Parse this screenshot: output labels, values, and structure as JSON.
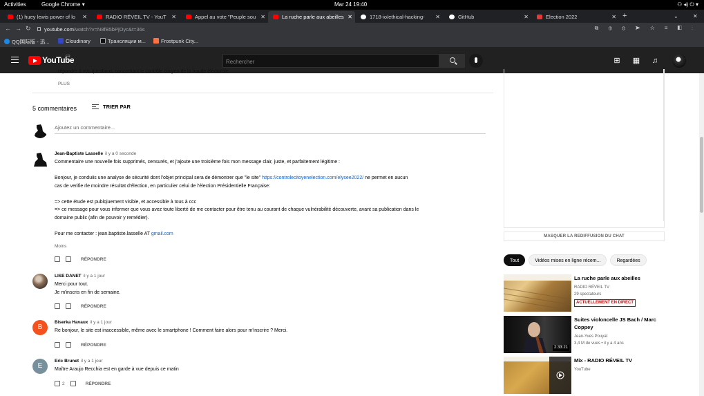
{
  "system": {
    "activities": "Activities",
    "app": "Google Chrome ▾",
    "clock": "Mar 24  19:40"
  },
  "tabs": [
    {
      "label": "(1) huey lewis power of lo",
      "icon": "youtube-icon"
    },
    {
      "label": "RADIO RÉVEIL TV - YouT",
      "icon": "youtube-icon"
    },
    {
      "label": "Appel au vote \"Peuple sou",
      "icon": "youtube-icon"
    },
    {
      "label": "La ruche parle aux abeilles",
      "icon": "youtube-icon"
    },
    {
      "label": "1718-io/ethical-hacking-",
      "icon": "github-icon"
    },
    {
      "label": "GitHub",
      "icon": "github-icon"
    },
    {
      "label": "Election 2022",
      "icon": "election-icon"
    }
  ],
  "address": {
    "host": "youtube.com",
    "path": "/watch?v=N8fB5bPjOyc&t=36s"
  },
  "bookmarks": [
    {
      "label": "QQ国际版 - 迅...",
      "color": "#1e88e5"
    },
    {
      "label": "Cloudinary",
      "color": "#3448c5"
    },
    {
      "label": "Трансляции м...",
      "color": "#111111"
    },
    {
      "label": "Frostpunk City...",
      "color": "#ff7043"
    }
  ],
  "yt": {
    "logo": "YouTube",
    "region": "FR",
    "search_placeholder": "Rechercher"
  },
  "description": {
    "text": "répondre à vos questions, concernant le contrôle citoyen de la fraude électorale.",
    "more": "PLUS"
  },
  "comments_header": {
    "count": "5 commentaires",
    "sort": "TRIER PAR",
    "add_placeholder": "Ajoutez un commentaire..."
  },
  "comments": [
    {
      "author": "Jean-Baptiste Lasselle",
      "time": "il y a 0 seconde",
      "lines": [
        "Commentaire une nouvelle fois supprimés, censurés, et j'ajoute une troisième fois mon message clair, juste, et parfaitement légitime :",
        "",
        "Bonjour, je conduiis une analyse de sécurité dont l'objet principal sera de démontrer que \"le site\" ",
        "cas de verifie rle moindre résultat d'élection, en particulier celui de l'élection Présidentielle Française:",
        "",
        "=> cette étude est publqiuement visible, et accessible à tous à ccc",
        "=> ce message pour vous informer que vous avez toute liberté de me contacter pour être tenu au courant de chaque vulnérabilité découverte, avant sa publication dans le",
        "domaine public (afin de pouvoir y remédier).",
        "",
        "Pour me contacter : jean.baptiste.lasselle  AT "
      ],
      "link": "https://controlecitoyenelection.com/elysee2022/",
      "link_after": " ne permet en aucun",
      "email_link": "gmail.com",
      "less": "Moins",
      "reply": "RÉPONDRE",
      "likes": ""
    },
    {
      "author": "LISE DANET",
      "time": "il y a 1 jour",
      "lines": [
        "Merci pour tout.",
        "Je m'inscris en fin de semaine."
      ],
      "reply": "RÉPONDRE",
      "likes": ""
    },
    {
      "author": "Biserka Havaux",
      "time": "il y a 1 jour",
      "letter": "B",
      "color": "#f4511e",
      "lines": [
        "Re bonjour, le site est inaccessible, même avec le smartphone ! Comment faire alors pour m'inscrire ? Merci."
      ],
      "reply": "RÉPONDRE",
      "likes": ""
    },
    {
      "author": "Eric Brunet",
      "time": "il y a 1 jour",
      "letter": "E",
      "color": "#78909c",
      "lines": [
        "Maître Araujo Recchia est en garde à vue depuis ce matin"
      ],
      "reply": "RÉPONDRE",
      "likes": "2"
    }
  ],
  "sidebar": {
    "hide_chat": "MASQUER LA REDIFFUSION DU CHAT",
    "chips": [
      "Tout",
      "Vidéos mises en ligne récem...",
      "Regardées"
    ],
    "recs": [
      {
        "title": "La ruche parle aux abeilles",
        "channel": "RADIO RÉVEIL TV",
        "meta": "29 spectateurs",
        "badge": "ACTUELLEMENT EN DIRECT"
      },
      {
        "title": "Suites violoncelle JS Bach / Marc Coppey",
        "channel": "Jean-Yves Pouyat",
        "meta": "3,4 M de vues • il y a 4 ans",
        "duration": "2:33:21"
      },
      {
        "title": "Mix - RADIO RÉVEIL TV",
        "channel": "YouTube",
        "meta": ""
      }
    ]
  }
}
